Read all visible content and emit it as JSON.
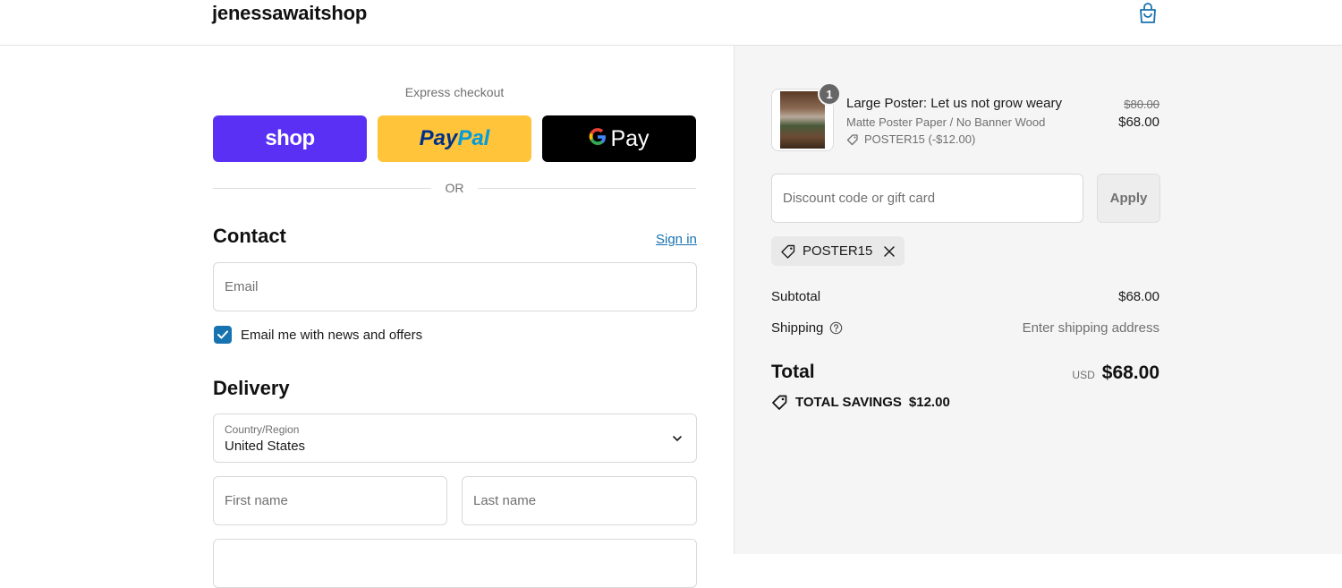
{
  "header": {
    "shop_name": "jenessawaitshop"
  },
  "express": {
    "label": "Express checkout",
    "shop_pay": "shop",
    "paypal_a": "Pay",
    "paypal_b": "Pal",
    "gpay_g": "G",
    "gpay_label": "Pay",
    "or": "OR"
  },
  "contact": {
    "title": "Contact",
    "sign_in": "Sign in",
    "email_placeholder": "Email",
    "news_checkbox_label": "Email me with news and offers",
    "news_checked": true
  },
  "delivery": {
    "title": "Delivery",
    "country_label": "Country/Region",
    "country_value": "United States",
    "first_name_placeholder": "First name",
    "last_name_placeholder": "Last name"
  },
  "summary": {
    "item": {
      "quantity": "1",
      "title": "Large Poster: Let us not grow weary",
      "variant": "Matte Poster Paper / No Banner Wood",
      "discount": "POSTER15 (-$12.00)",
      "price_original": "$80.00",
      "price_final": "$68.00"
    },
    "discount_placeholder": "Discount code or gift card",
    "apply_label": "Apply",
    "applied_code": "POSTER15",
    "subtotal_label": "Subtotal",
    "subtotal_value": "$68.00",
    "shipping_label": "Shipping",
    "shipping_value": "Enter shipping address",
    "total_label": "Total",
    "total_currency": "USD",
    "total_value": "$68.00",
    "savings_label": "TOTAL SAVINGS",
    "savings_value": "$12.00"
  },
  "colors": {
    "shop_pay": "#5a31f4",
    "paypal": "#ffc439",
    "link": "#1773b0"
  }
}
